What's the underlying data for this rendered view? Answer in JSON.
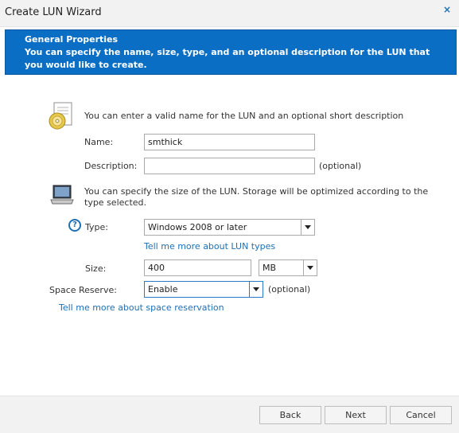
{
  "window": {
    "title": "Create LUN Wizard",
    "close_glyph": "×"
  },
  "banner": {
    "title": "General Properties",
    "description": "You can specify the name, size, type, and an optional description for the LUN that you would like to create."
  },
  "name_section": {
    "icon": "disk-document-icon",
    "description": "You can enter a valid name for the LUN and an optional short description",
    "name_label": "Name:",
    "name_value": "smthick",
    "description_label": "Description:",
    "description_value": "",
    "optional_text": "(optional)"
  },
  "size_section": {
    "icon": "laptop-icon",
    "description": "You can specify the size of the LUN. Storage will be optimized according to the type selected.",
    "help_glyph": "?",
    "type_label": "Type:",
    "type_value": "Windows 2008 or later",
    "type_link": "Tell me more about LUN types",
    "size_label": "Size:",
    "size_value": "400",
    "unit_value": "MB",
    "space_reserve_label": "Space Reserve:",
    "space_reserve_value": "Enable",
    "space_reserve_optional": "(optional)",
    "space_link": "Tell me more about space reservation"
  },
  "footer": {
    "back_label": "Back",
    "next_label": "Next",
    "cancel_label": "Cancel"
  },
  "colors": {
    "banner_bg": "#0a6ec4",
    "link": "#1f6fb5",
    "focus_border": "#2a7ac8"
  }
}
